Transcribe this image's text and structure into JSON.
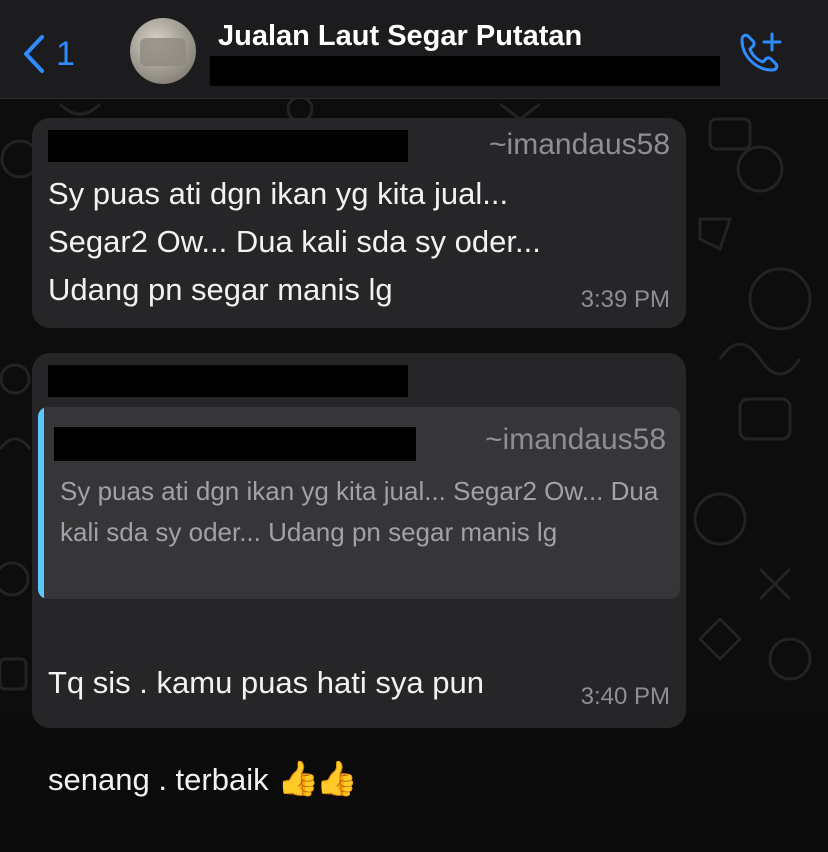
{
  "header": {
    "back_count": "1",
    "title": "Jualan Laut Segar Putatan"
  },
  "messages": [
    {
      "sender": "~imandaus58",
      "text": "Sy puas ati dgn ikan yg kita jual...\nSegar2 Ow... Dua kali sda sy oder...\nUdang pn segar manis lg",
      "time": "3:39 PM"
    },
    {
      "quoted_sender": "~imandaus58",
      "quoted_text": "Sy puas ati dgn ikan yg kita jual... Segar2 Ow... Dua kali sda sy oder... Udang pn segar manis lg",
      "text_line1": "Tq sis . kamu puas hati sya pun",
      "text_line2": "senang . terbaik ",
      "emoji": "👍👍",
      "time": "3:40 PM"
    }
  ],
  "colors": {
    "accent": "#2f8cff",
    "quote_bar": "#5ac8fa",
    "bubble": "#262628",
    "background": "#0d0d0d"
  },
  "icons": [
    "back-chevron-icon",
    "add-call-icon"
  ]
}
